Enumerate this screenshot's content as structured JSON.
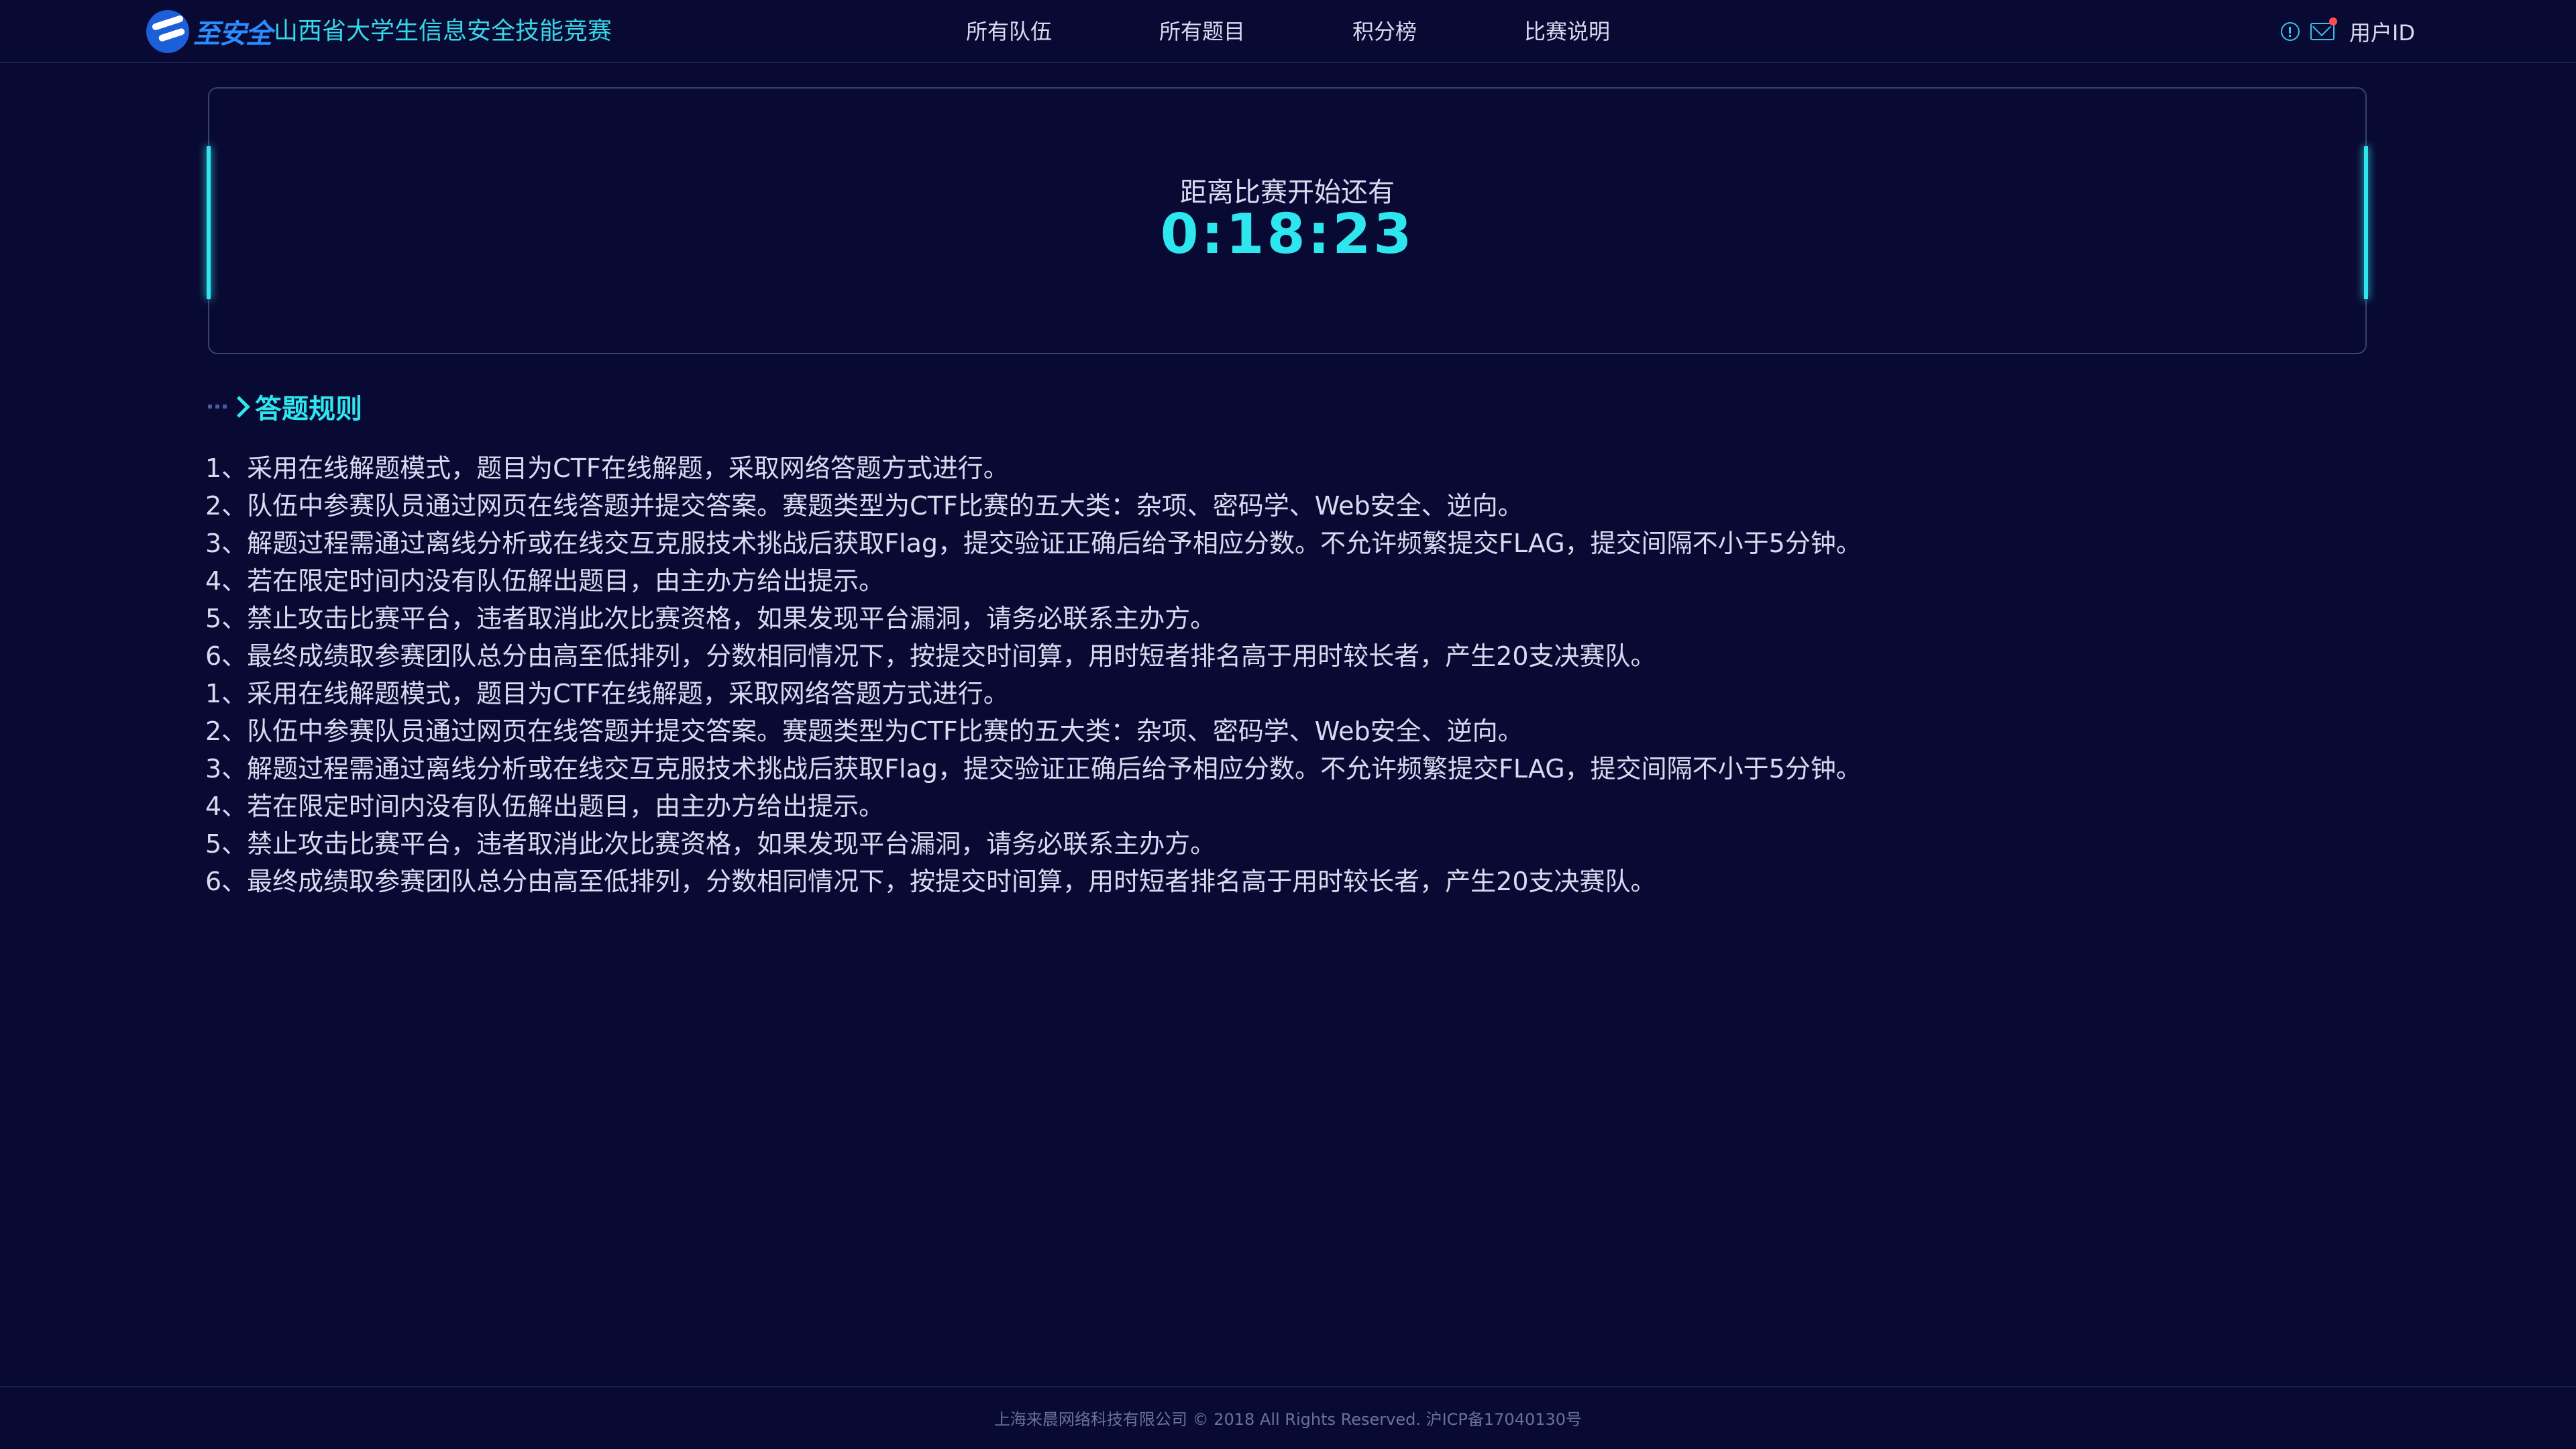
{
  "header": {
    "logo_text": "至安全",
    "site_title": "山西省大学生信息安全技能竞赛",
    "nav": [
      "所有队伍",
      "所有题目",
      "积分榜",
      "比赛说明"
    ],
    "user_label": "用户ID"
  },
  "countdown": {
    "label": "距离比赛开始还有",
    "time": "0:18:23"
  },
  "rules": {
    "title": "答题规则",
    "items": [
      "1、采用在线解题模式，题目为CTF在线解题，采取网络答题方式进行。",
      "2、队伍中参赛队员通过网页在线答题并提交答案。赛题类型为CTF比赛的五大类：杂项、密码学、Web安全、逆向。",
      "3、解题过程需通过离线分析或在线交互克服技术挑战后获取Flag，提交验证正确后给予相应分数。不允许频繁提交FLAG，提交间隔不小于5分钟。",
      "4、若在限定时间内没有队伍解出题目，由主办方给出提示。",
      "5、禁止攻击比赛平台，违者取消此次比赛资格，如果发现平台漏洞，请务必联系主办方。",
      "6、最终成绩取参赛团队总分由高至低排列，分数相同情况下，按提交时间算，用时短者排名高于用时较长者，产生20支决赛队。",
      "1、采用在线解题模式，题目为CTF在线解题，采取网络答题方式进行。",
      "2、队伍中参赛队员通过网页在线答题并提交答案。赛题类型为CTF比赛的五大类：杂项、密码学、Web安全、逆向。",
      "3、解题过程需通过离线分析或在线交互克服技术挑战后获取Flag，提交验证正确后给予相应分数。不允许频繁提交FLAG，提交间隔不小于5分钟。",
      "4、若在限定时间内没有队伍解出题目，由主办方给出提示。",
      "5、禁止攻击比赛平台，违者取消此次比赛资格，如果发现平台漏洞，请务必联系主办方。",
      "6、最终成绩取参赛团队总分由高至低排列，分数相同情况下，按提交时间算，用时短者排名高于用时较长者，产生20支决赛队。"
    ]
  },
  "footer": {
    "text": "上海来晨网络科技有限公司 © 2018 All Rights Reserved.  沪ICP备17040130号"
  },
  "colors": {
    "background": "#090a33",
    "accent": "#2ee6ee",
    "text": "#d8dbf0",
    "notification": "#ff4d4f"
  }
}
